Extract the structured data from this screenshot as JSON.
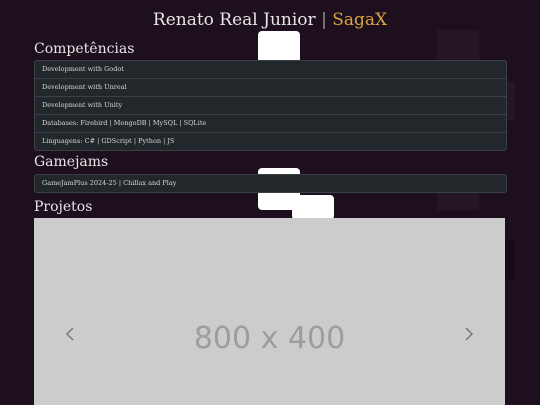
{
  "header": {
    "name": "Renato Real Junior",
    "separator": "|",
    "brand": "SagaX"
  },
  "sections": {
    "skills": {
      "title": "Competências",
      "items": [
        "Development with Godot",
        "Development with Unreal",
        "Development with Unity",
        "Databases: Firebird | MongoDB | MySQL | SQLite",
        "Linguagens: C# | GDScript | Python | JS"
      ]
    },
    "gamejams": {
      "title": "Gamejams",
      "items": [
        "GameJamPlus 2024-25 | Chillax and Play"
      ]
    },
    "projects": {
      "title": "Projetos",
      "carousel": {
        "placeholder": "800 x 400",
        "prev_icon": "chevron-left-icon",
        "next_icon": "chevron-right-icon"
      }
    }
  },
  "colors": {
    "background": "#1d0f1d",
    "brand": "#d9a441",
    "list_bg": "#22272b",
    "placeholder_bg": "#cccccc"
  }
}
